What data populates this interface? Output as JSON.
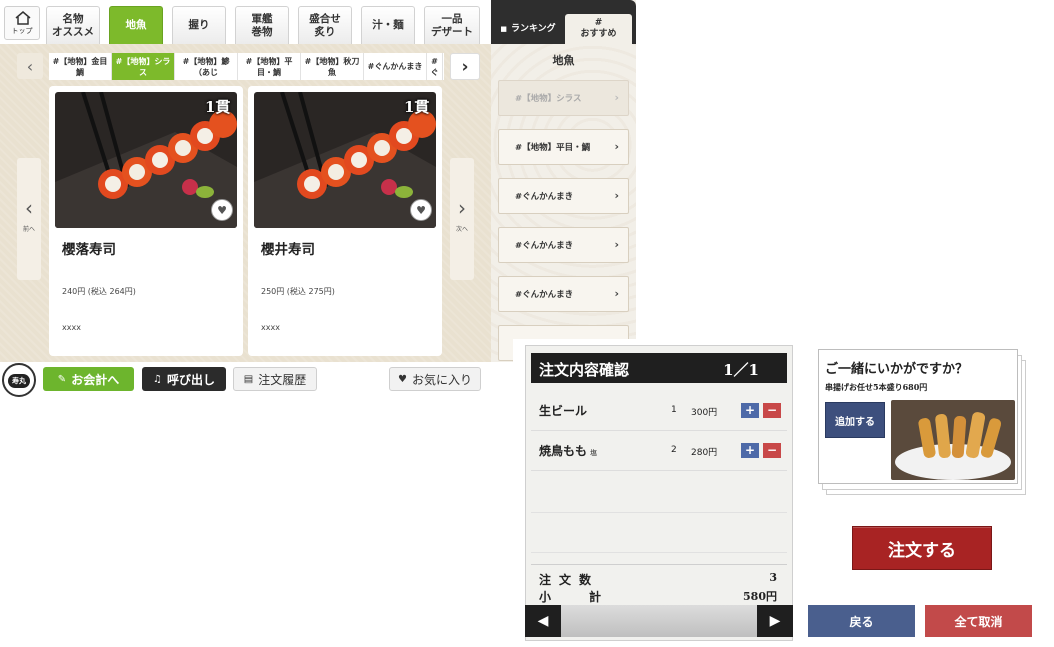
{
  "top_nav": {
    "home_label": "トップ",
    "tabs": [
      {
        "label": "名物\nオススメ"
      },
      {
        "label": "地魚"
      },
      {
        "label": "握り"
      },
      {
        "label": "軍艦\n巻物"
      },
      {
        "label": "盛合せ\n炙り"
      },
      {
        "label": "汁・麺"
      },
      {
        "label": "一品\nデザート"
      }
    ]
  },
  "tags": [
    {
      "label": "#【地物】金目鯛"
    },
    {
      "label": "#【地物】シラス"
    },
    {
      "label": "#【地物】鯵（あじ"
    },
    {
      "label": "#【地物】平目・鯛"
    },
    {
      "label": "#【地物】秋刀魚"
    },
    {
      "label": "#ぐんかんまき"
    },
    {
      "label": "#ぐ"
    }
  ],
  "nav": {
    "prev_label": "前へ",
    "next_label": "次へ"
  },
  "products": [
    {
      "name": "櫻落寿司",
      "price": "240円 (税込 264円)",
      "desc": "xxxx",
      "badge": "1貫"
    },
    {
      "name": "櫻井寿司",
      "price": "250円 (税込 275円)",
      "desc": "xxxx",
      "badge": "1貫"
    }
  ],
  "bottom": {
    "logo_text": "寿丸",
    "pay": "お会計へ",
    "call": "呼び出し",
    "history": "注文履歴",
    "favorite": "お気に入り"
  },
  "side_panel": {
    "tab_ranking": "ランキング",
    "tab_recommend": "#\nおすすめ",
    "title": "地魚",
    "items": [
      {
        "label": "#【地物】シラス"
      },
      {
        "label": "#【地物】平目・鯛"
      },
      {
        "label": "#ぐんかんまき"
      },
      {
        "label": "#ぐんかんまき"
      },
      {
        "label": "#ぐんかんまき"
      }
    ]
  },
  "order_confirm": {
    "title": "注文内容確認",
    "page": "1／1",
    "items": [
      {
        "name": "生ビール",
        "note": "",
        "qty": "1",
        "price": "300円"
      },
      {
        "name": "焼鳥もも",
        "note": "塩",
        "qty": "2",
        "price": "280円"
      }
    ],
    "count_label": "注文数",
    "count_value": "3",
    "subtotal_label": "小計",
    "subtotal_value": "580円",
    "suggestion_title": "ご一緒にいかがですか？",
    "suggestion_item": "串揚げお任せ5本盛り680円",
    "add_label": "追加する",
    "order_button": "注文する",
    "back_button": "戻る",
    "clear_button": "全て取消"
  },
  "colors": {
    "accent_green": "#7dba2b",
    "order_red": "#a82323",
    "plus_blue": "#4e6aa8",
    "minus_red": "#c84848"
  }
}
